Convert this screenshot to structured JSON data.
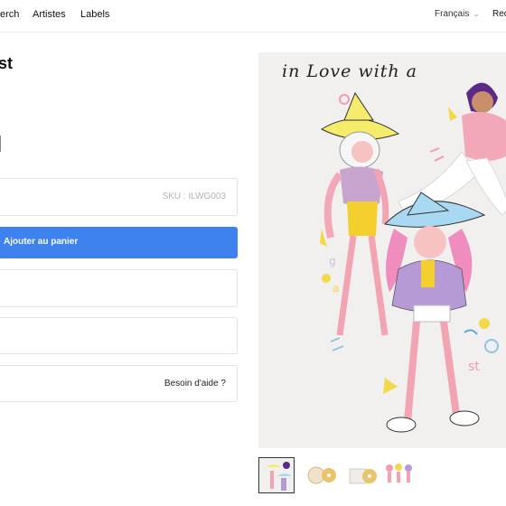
{
  "nav": {
    "items": [
      "erch",
      "Artistes",
      "Labels"
    ],
    "language": "Français",
    "right_item": "Rec"
  },
  "product": {
    "title": "st",
    "sku": "SKU : ILWG003",
    "add_to_cart": "Ajouter au panier",
    "help": "Besoin d'aide ?"
  },
  "artwork": {
    "handwritten_text": "in Love with a"
  },
  "colors": {
    "accent": "#3e82f0",
    "border": "#e3e3e3"
  },
  "icons": {
    "language_dropdown": "chevron-down-icon"
  }
}
